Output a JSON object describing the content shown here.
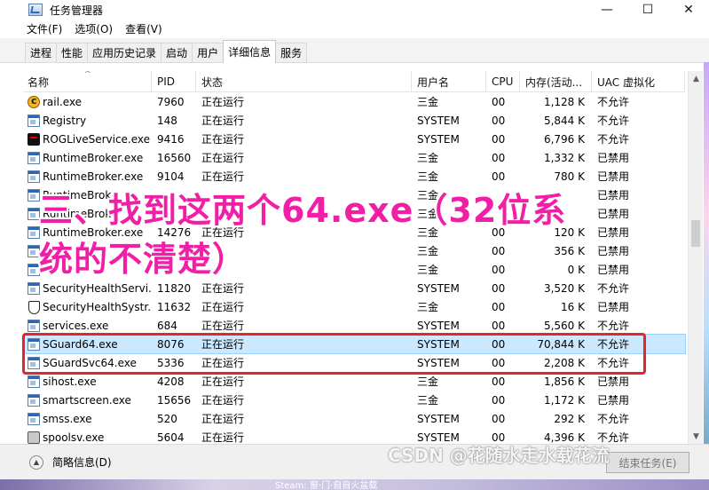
{
  "window": {
    "title": "任务管理器",
    "minimize": "—",
    "maximize": "☐",
    "close": "✕"
  },
  "menu": [
    "文件(F)",
    "选项(O)",
    "查看(V)"
  ],
  "tabs": [
    "进程",
    "性能",
    "应用历史记录",
    "启动",
    "用户",
    "详细信息",
    "服务"
  ],
  "active_tab": "详细信息",
  "columns": [
    "名称",
    "PID",
    "状态",
    "用户名",
    "CPU",
    "内存(活动...",
    "UAC 虚拟化"
  ],
  "rows": [
    {
      "icon": "rail",
      "name": "rail.exe",
      "pid": "7960",
      "status": "正在运行",
      "user": "三金",
      "cpu": "00",
      "mem": "1,128 K",
      "uac": "不允许"
    },
    {
      "icon": "window",
      "name": "Registry",
      "pid": "148",
      "status": "正在运行",
      "user": "SYSTEM",
      "cpu": "00",
      "mem": "5,844 K",
      "uac": "不允许"
    },
    {
      "icon": "rog",
      "name": "ROGLiveService.exe",
      "pid": "9416",
      "status": "正在运行",
      "user": "SYSTEM",
      "cpu": "00",
      "mem": "6,796 K",
      "uac": "不允许"
    },
    {
      "icon": "window",
      "name": "RuntimeBroker.exe",
      "pid": "16560",
      "status": "正在运行",
      "user": "三金",
      "cpu": "00",
      "mem": "1,332 K",
      "uac": "已禁用"
    },
    {
      "icon": "window",
      "name": "RuntimeBroker.exe",
      "pid": "9104",
      "status": "正在运行",
      "user": "三金",
      "cpu": "00",
      "mem": "780 K",
      "uac": "已禁用"
    },
    {
      "icon": "window",
      "name": "RuntimeBrok",
      "pid": "",
      "status": "",
      "user": "三金",
      "cpu": "",
      "mem": "",
      "uac": "已禁用"
    },
    {
      "icon": "window",
      "name": "RuntimeBrok",
      "pid": "",
      "status": "",
      "user": "三金",
      "cpu": "",
      "mem": "",
      "uac": "已禁用"
    },
    {
      "icon": "window",
      "name": "RuntimeBroker.exe",
      "pid": "14276",
      "status": "正在运行",
      "user": "三金",
      "cpu": "00",
      "mem": "120 K",
      "uac": "已禁用"
    },
    {
      "icon": "window",
      "name": "",
      "pid": "",
      "status": "",
      "user": "三金",
      "cpu": "00",
      "mem": "356 K",
      "uac": "已禁用"
    },
    {
      "icon": "window",
      "name": "",
      "pid": "",
      "status": "",
      "user": "三金",
      "cpu": "00",
      "mem": "0 K",
      "uac": "已禁用"
    },
    {
      "icon": "window",
      "name": "SecurityHealthServi...",
      "pid": "11820",
      "status": "正在运行",
      "user": "SYSTEM",
      "cpu": "00",
      "mem": "3,520 K",
      "uac": "不允许"
    },
    {
      "icon": "shield",
      "name": "SecurityHealthSystr...",
      "pid": "11632",
      "status": "正在运行",
      "user": "三金",
      "cpu": "00",
      "mem": "16 K",
      "uac": "已禁用"
    },
    {
      "icon": "window",
      "name": "services.exe",
      "pid": "684",
      "status": "正在运行",
      "user": "SYSTEM",
      "cpu": "00",
      "mem": "5,560 K",
      "uac": "不允许"
    },
    {
      "icon": "window",
      "name": "SGuard64.exe",
      "pid": "8076",
      "status": "正在运行",
      "user": "SYSTEM",
      "cpu": "00",
      "mem": "70,844 K",
      "uac": "不允许",
      "selected": true
    },
    {
      "icon": "window",
      "name": "SGuardSvc64.exe",
      "pid": "5336",
      "status": "正在运行",
      "user": "SYSTEM",
      "cpu": "00",
      "mem": "2,208 K",
      "uac": "不允许"
    },
    {
      "icon": "window",
      "name": "sihost.exe",
      "pid": "4208",
      "status": "正在运行",
      "user": "三金",
      "cpu": "00",
      "mem": "1,856 K",
      "uac": "已禁用"
    },
    {
      "icon": "window",
      "name": "smartscreen.exe",
      "pid": "15656",
      "status": "正在运行",
      "user": "三金",
      "cpu": "00",
      "mem": "1,172 K",
      "uac": "已禁用"
    },
    {
      "icon": "window",
      "name": "smss.exe",
      "pid": "520",
      "status": "正在运行",
      "user": "SYSTEM",
      "cpu": "00",
      "mem": "292 K",
      "uac": "不允许"
    },
    {
      "icon": "printer",
      "name": "spoolsv.exe",
      "pid": "5604",
      "status": "正在运行",
      "user": "SYSTEM",
      "cpu": "00",
      "mem": "4,396 K",
      "uac": "不允许"
    }
  ],
  "footer": {
    "fewer_details": "简略信息(D)",
    "end_task": "结束任务(E)"
  },
  "overlay_caption_line1": "三、找到这两个64.exe（32位系",
  "overlay_caption_line2": "统的不清楚）",
  "watermark": "CSDN @花随水走水载花流",
  "desktop_text": "Steam: 窗·门·自自火盆载",
  "colors": {
    "caption": "#f11fa6",
    "highlight_box": "#e0262f",
    "selected_row": "#cce8ff"
  }
}
